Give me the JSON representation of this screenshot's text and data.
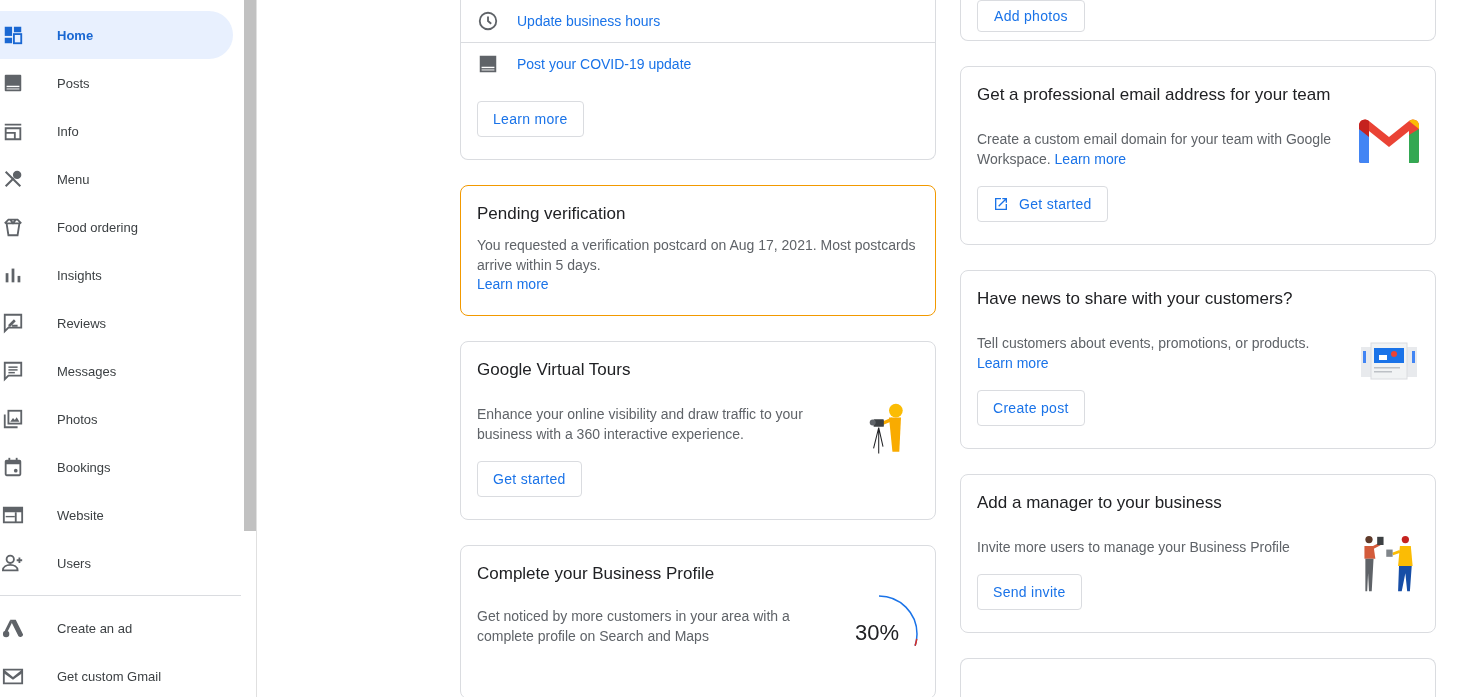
{
  "sidebar": {
    "items": [
      {
        "label": "Home",
        "selected": true
      },
      {
        "label": "Posts",
        "selected": false
      },
      {
        "label": "Info",
        "selected": false
      },
      {
        "label": "Menu",
        "selected": false
      },
      {
        "label": "Food ordering",
        "selected": false
      },
      {
        "label": "Insights",
        "selected": false
      },
      {
        "label": "Reviews",
        "selected": false
      },
      {
        "label": "Messages",
        "selected": false
      },
      {
        "label": "Photos",
        "selected": false
      },
      {
        "label": "Bookings",
        "selected": false
      },
      {
        "label": "Website",
        "selected": false
      },
      {
        "label": "Users",
        "selected": false
      }
    ],
    "extra_items": [
      {
        "label": "Create an ad"
      },
      {
        "label": "Get custom Gmail"
      }
    ]
  },
  "column_1": [
    {
      "kind": "links",
      "links": [
        "Update business hours",
        "Post your COVID-19 update"
      ],
      "button": "Learn more"
    },
    {
      "kind": "notice",
      "title": "Pending verification",
      "text": "You requested a verification postcard on Aug 17, 2021. Most postcards arrive within 5 days.",
      "link": "Learn more"
    },
    {
      "kind": "promo",
      "title": "Google Virtual Tours",
      "text": "Enhance your online visibility and draw traffic to your business with a 360 interactive experience.",
      "button": "Get started"
    },
    {
      "kind": "progress",
      "title": "Complete your Business Profile",
      "text": "Get noticed by more customers in your area with a complete profile on Search and Maps",
      "level": 0.3,
      "reading": "30%"
    }
  ],
  "column_2": [
    {
      "kind": "button_only",
      "button": "Add photos"
    },
    {
      "kind": "promo",
      "title": "Get a professional email address for your team",
      "text": "Create a custom email domain for your team with Google Workspace.",
      "link": "Learn more",
      "button": "Get started"
    },
    {
      "kind": "promo",
      "title": "Have news to share with your customers?",
      "text": "Tell customers about events, promotions, or products.",
      "link": "Learn more",
      "button": "Create post"
    },
    {
      "kind": "promo",
      "title": "Add a manager to your business",
      "text": "Invite more users to manage your Business Profile",
      "button": "Send invite"
    }
  ]
}
